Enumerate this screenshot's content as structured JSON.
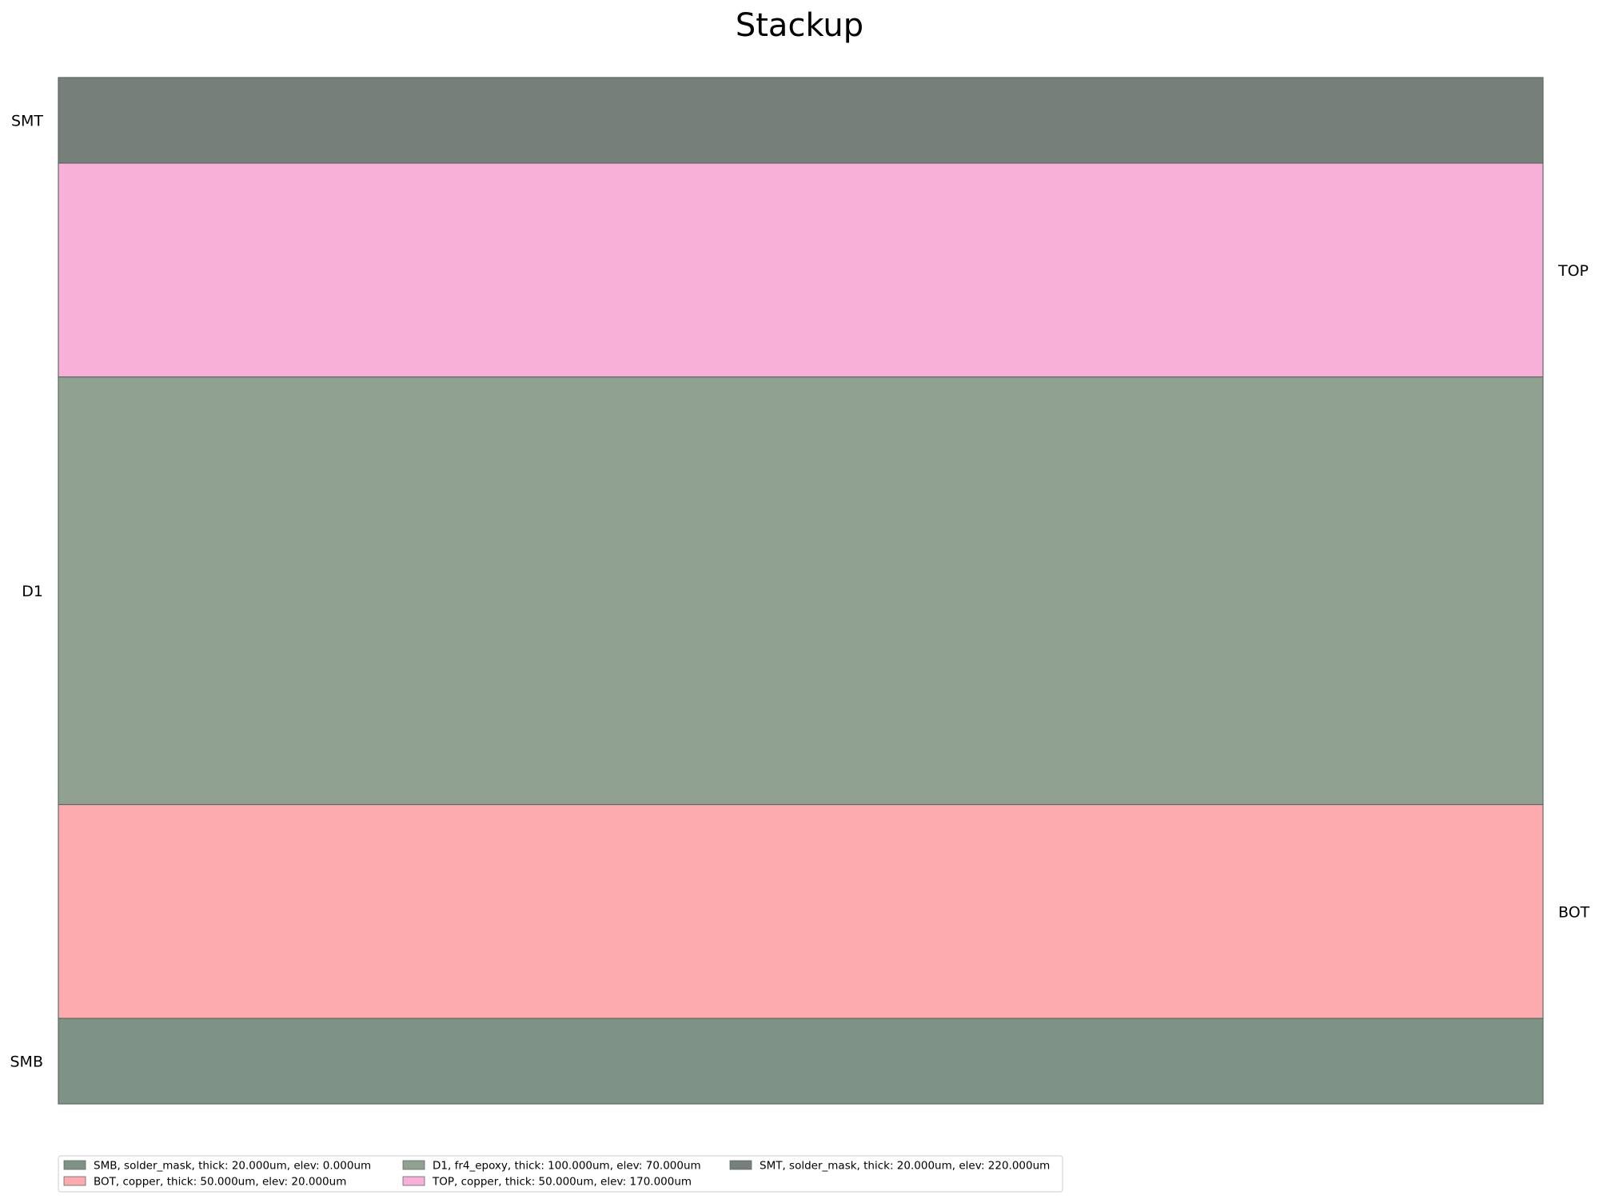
{
  "chart_data": {
    "type": "stackup",
    "title": "Stackup",
    "xlabel": "",
    "ylabel": "",
    "units": "um",
    "ylim": [
      0,
      240
    ],
    "grid": false,
    "legend_placement": "bottom-left",
    "legend_columns": 3,
    "layers": [
      {
        "name": "SMB",
        "material": "solder_mask",
        "thickness": 20.0,
        "elevation": 0.0,
        "color": "#7e9285",
        "label_side": "left",
        "legend_label": "SMB, solder_mask, thick: 20.000um, elev: 0.000um"
      },
      {
        "name": "BOT",
        "material": "copper",
        "thickness": 50.0,
        "elevation": 20.0,
        "color": "#fdabaf",
        "label_side": "right",
        "legend_label": "BOT, copper, thick: 50.000um, elev: 20.000um"
      },
      {
        "name": "D1",
        "material": "fr4_epoxy",
        "thickness": 100.0,
        "elevation": 70.0,
        "color": "#90a091",
        "label_side": "left",
        "legend_label": "D1, fr4_epoxy, thick: 100.000um, elev: 70.000um"
      },
      {
        "name": "TOP",
        "material": "copper",
        "thickness": 50.0,
        "elevation": 170.0,
        "color": "#f8b0d9",
        "label_side": "right",
        "legend_label": "TOP, copper, thick: 50.000um, elev: 170.000um"
      },
      {
        "name": "SMT",
        "material": "solder_mask",
        "thickness": 20.0,
        "elevation": 220.0,
        "color": "#767f79",
        "label_side": "left",
        "legend_label": "SMT, solder_mask, thick: 20.000um, elev: 220.000um"
      }
    ]
  }
}
